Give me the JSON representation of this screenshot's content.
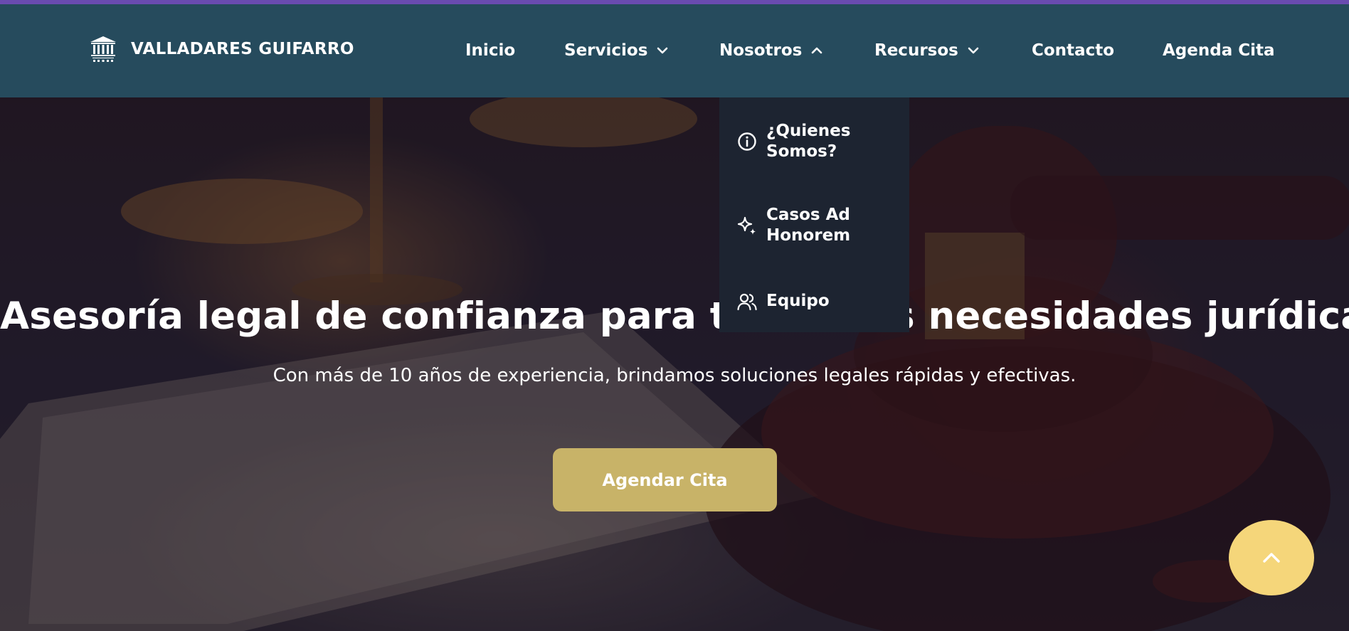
{
  "brand": {
    "name": "VALLADARES GUIFARRO",
    "logo_icon": "courthouse-columns-logo"
  },
  "nav": {
    "items": [
      {
        "label": "Inicio",
        "has_dropdown": false
      },
      {
        "label": "Servicios",
        "has_dropdown": true,
        "chevron": "chevron-down-icon"
      },
      {
        "label": "Nosotros",
        "has_dropdown": true,
        "chevron": "chevron-up-icon",
        "expanded": true
      },
      {
        "label": "Recursos",
        "has_dropdown": true,
        "chevron": "chevron-down-icon"
      },
      {
        "label": "Contacto",
        "has_dropdown": false
      },
      {
        "label": "Agenda Cita",
        "has_dropdown": false
      }
    ]
  },
  "dropdown": {
    "items": [
      {
        "label": "¿Quienes Somos?",
        "icon": "info-icon"
      },
      {
        "label": "Casos Ad Honorem",
        "icon": "sparkles-icon"
      },
      {
        "label": "Equipo",
        "icon": "users-icon"
      }
    ]
  },
  "hero": {
    "title": "Asesoría legal de confianza para todas sus necesidades jurídicas",
    "subtitle": "Con más de 10 años de experiencia, brindamos soluciones legales rápidas y efectivas.",
    "cta_label": "Agendar Cita"
  },
  "scroll_top": {
    "icon": "chevron-up-icon"
  },
  "colors": {
    "header_bg": "#264b5d",
    "top_strip": "#6a4bb0",
    "dropdown_bg": "#1d2431",
    "cta_bg": "#c8b368",
    "scroll_top_bg": "#f5d67a"
  }
}
